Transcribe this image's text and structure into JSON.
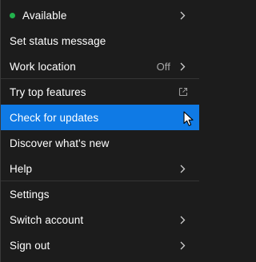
{
  "menu": {
    "status": {
      "label": "Available",
      "dot_color": "#22b14c"
    },
    "set_status_message": {
      "label": "Set status message"
    },
    "work_location": {
      "label": "Work location",
      "value": "Off"
    },
    "try_top_features": {
      "label": "Try top features"
    },
    "check_for_updates": {
      "label": "Check for updates",
      "highlight_color": "#0f7ae5"
    },
    "discover_whats_new": {
      "label": "Discover what's new"
    },
    "help": {
      "label": "Help"
    },
    "settings": {
      "label": "Settings"
    },
    "switch_account": {
      "label": "Switch account"
    },
    "sign_out": {
      "label": "Sign out"
    }
  },
  "icons": {
    "chevron": "chevron-right-icon",
    "external": "external-link-icon",
    "cursor": "mouse-pointer-icon"
  }
}
